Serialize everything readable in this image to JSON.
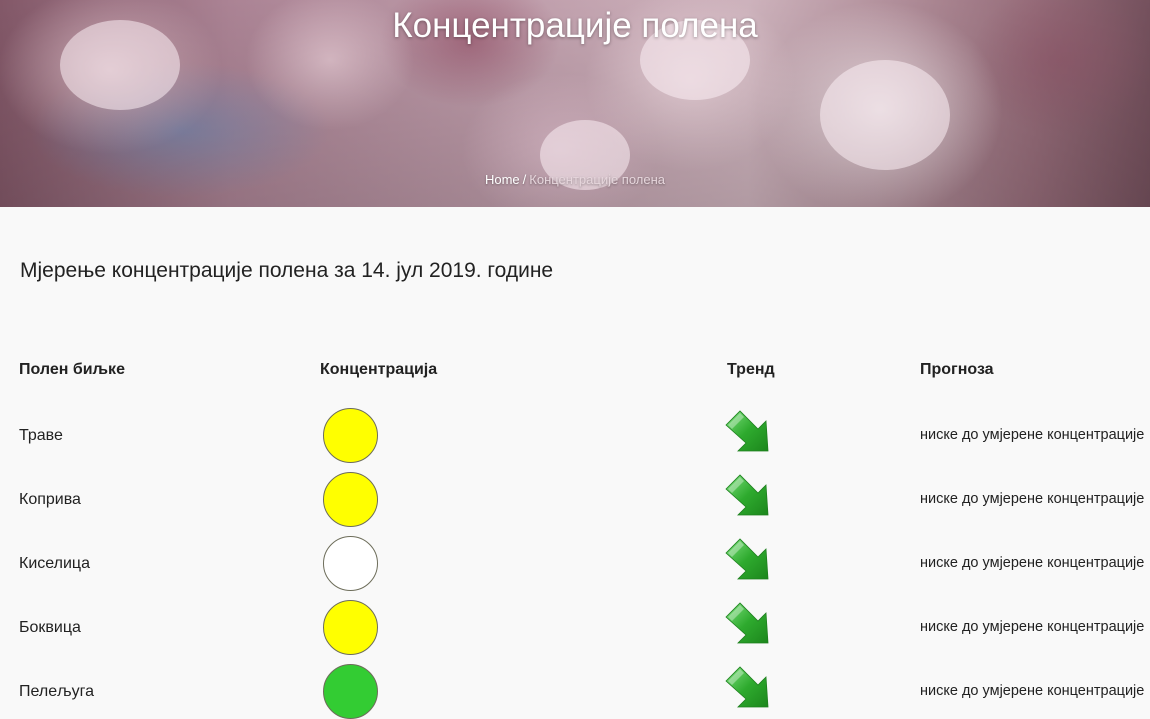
{
  "hero": {
    "title": "Концентрације полена",
    "breadcrumb": {
      "home": "Home",
      "separator": "/",
      "current": "Концентрације полена"
    }
  },
  "heading": "Мјерење концентрације полена за 14. јул 2019. године",
  "table": {
    "columns": [
      "Полен биљке",
      "Концентрација",
      "Тренд",
      "Прогноза"
    ],
    "rows": [
      {
        "plant": "Траве",
        "concentration_color": "#ffff00",
        "trend": "down-arrow-icon",
        "forecast": "ниске до умјерене концентрације"
      },
      {
        "plant": "Коприва",
        "concentration_color": "#ffff00",
        "trend": "down-arrow-icon",
        "forecast": "ниске до умјерене концентрације"
      },
      {
        "plant": "Киселица",
        "concentration_color": "#ffffff",
        "trend": "down-arrow-icon",
        "forecast": "ниске до умјерене концентрације"
      },
      {
        "plant": "Боквица",
        "concentration_color": "#ffff00",
        "trend": "down-arrow-icon",
        "forecast": "ниске до умјерене концентрације"
      },
      {
        "plant": "Пелељуга",
        "concentration_color": "#33cc33",
        "trend": "down-arrow-icon",
        "forecast": "ниске до умјерене концентрације"
      }
    ]
  },
  "colors": {
    "trend_arrow": "#2eaa2e"
  }
}
